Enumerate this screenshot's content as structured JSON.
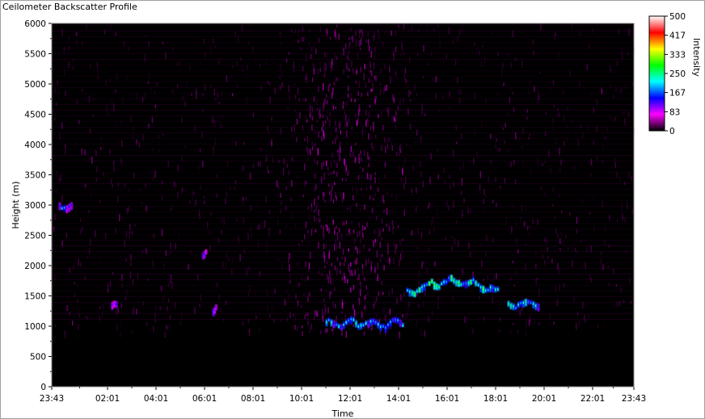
{
  "window": {
    "title": "Ceilometer Backscatter Profile"
  },
  "chart_data": {
    "type": "heatmap",
    "title": "Ceilometer Backscatter Profile",
    "xlabel": "Time",
    "ylabel": "Height (m)",
    "x_tick_labels": [
      "23:43",
      "02:01",
      "04:01",
      "06:01",
      "08:01",
      "10:01",
      "12:01",
      "14:01",
      "16:01",
      "18:01",
      "20:01",
      "22:01",
      "23:43"
    ],
    "y_ticks": [
      0,
      500,
      1000,
      1500,
      2000,
      2500,
      3000,
      3500,
      4000,
      4500,
      5000,
      5500,
      6000
    ],
    "ylim": [
      0,
      6000
    ],
    "colorbar": {
      "label": "Intensity",
      "ticks": [
        0,
        83,
        167,
        250,
        333,
        417,
        500
      ],
      "tick_labels": [
        "0",
        "83",
        "167",
        "250",
        "333",
        "417",
        "500"
      ],
      "range": [
        0,
        500
      ],
      "colors": [
        "#000000",
        "#ff00ff",
        "#0000ff",
        "#00ffff",
        "#00ff00",
        "#ffff00",
        "#ff0000",
        "#ffffff"
      ]
    },
    "background_color": "#000000",
    "features": [
      {
        "time_range": [
          "00:00",
          "00:35"
        ],
        "height_m": 3000,
        "intensity": 140
      },
      {
        "time_range": [
          "02:10",
          "02:25"
        ],
        "height_m": 1420,
        "intensity": 110
      },
      {
        "time_range": [
          "05:55",
          "06:05"
        ],
        "height_m": 2220,
        "intensity": 100
      },
      {
        "time_range": [
          "06:20",
          "06:30"
        ],
        "height_m": 1250,
        "intensity": 110
      },
      {
        "time_range": [
          "11:00",
          "14:15"
        ],
        "height_m": 1050,
        "intensity": 170
      },
      {
        "time_range": [
          "14:20",
          "18:10"
        ],
        "height_m": 1550,
        "intensity": 210
      },
      {
        "time_range": [
          "18:30",
          "19:50"
        ],
        "height_m": 1380,
        "intensity": 180
      }
    ]
  }
}
